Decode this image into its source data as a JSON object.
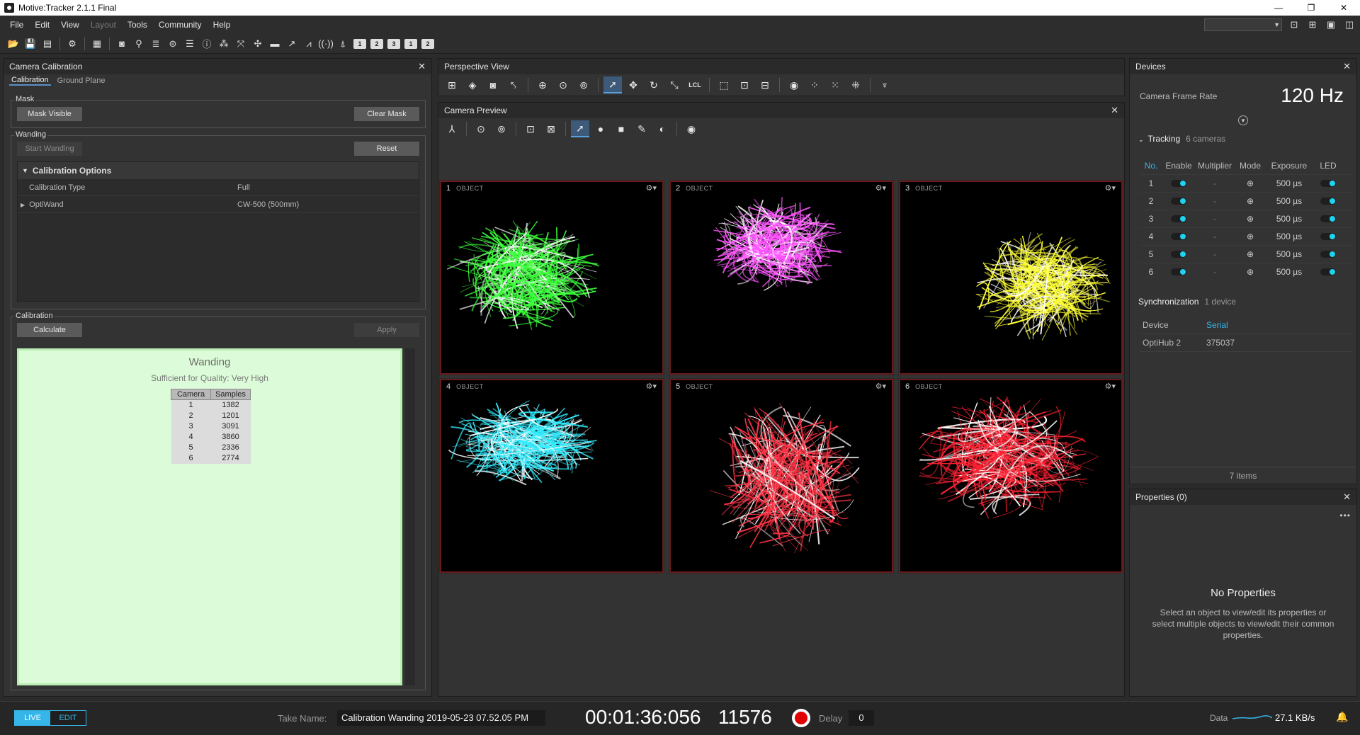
{
  "window": {
    "title": "Motive:Tracker 2.1.1 Final",
    "controls": [
      "—",
      "❐",
      "✕"
    ]
  },
  "menu": [
    "File",
    "Edit",
    "View",
    "Layout",
    "Tools",
    "Community",
    "Help"
  ],
  "toolbar_numbers": [
    "1",
    "2",
    "3",
    "1",
    "2"
  ],
  "calibration_panel": {
    "title": "Camera Calibration",
    "tabs": [
      "Calibration",
      "Ground Plane"
    ],
    "mask": {
      "title": "Mask",
      "mask_visible": "Mask Visible",
      "clear_mask": "Clear Mask"
    },
    "wanding": {
      "title": "Wanding",
      "start": "Start Wanding",
      "reset": "Reset",
      "options_title": "Calibration Options",
      "rows": [
        {
          "key": "Calibration Type",
          "value": "Full"
        },
        {
          "key": "OptiWand",
          "value": "CW-500 (500mm)"
        }
      ]
    },
    "calibration": {
      "title": "Calibration",
      "calculate": "Calculate",
      "apply": "Apply",
      "result_title": "Wanding",
      "result_sub": "Sufficient for Quality: Very High",
      "table_headers": [
        "Camera",
        "Samples"
      ],
      "table_rows": [
        [
          "1",
          "1382"
        ],
        [
          "2",
          "1201"
        ],
        [
          "3",
          "3091"
        ],
        [
          "4",
          "3860"
        ],
        [
          "5",
          "2336"
        ],
        [
          "6",
          "2774"
        ]
      ]
    }
  },
  "perspective": {
    "title": "Perspective View",
    "lcl_label": "LCL"
  },
  "camera_preview": {
    "title": "Camera Preview",
    "object_label": "OBJECT",
    "cameras": [
      {
        "num": "1",
        "color": "#3cff3c"
      },
      {
        "num": "2",
        "color": "#ff55ff"
      },
      {
        "num": "3",
        "color": "#ffff33"
      },
      {
        "num": "4",
        "color": "#33eeff"
      },
      {
        "num": "5",
        "color": "#ff3344"
      },
      {
        "num": "6",
        "color": "#ff2233"
      }
    ]
  },
  "devices": {
    "title": "Devices",
    "frame_rate_label": "Camera Frame Rate",
    "frame_rate_value": "120 Hz",
    "tracking_label": "Tracking",
    "tracking_sub": "6 cameras",
    "headers": [
      "No.",
      "Enable",
      "Multiplier",
      "Mode",
      "Exposure",
      "LED"
    ],
    "rows": [
      {
        "no": "1",
        "multiplier": "-",
        "exposure": "500 µs"
      },
      {
        "no": "2",
        "multiplier": "-",
        "exposure": "500 µs"
      },
      {
        "no": "3",
        "multiplier": "-",
        "exposure": "500 µs"
      },
      {
        "no": "4",
        "multiplier": "-",
        "exposure": "500 µs"
      },
      {
        "no": "5",
        "multiplier": "-",
        "exposure": "500 µs"
      },
      {
        "no": "6",
        "multiplier": "-",
        "exposure": "500 µs"
      }
    ],
    "sync_label": "Synchronization",
    "sync_sub": "1 device",
    "sync_headers": [
      "Device",
      "Serial"
    ],
    "sync_row": [
      "OptiHub 2",
      "375037"
    ],
    "items_count": "7 items"
  },
  "properties": {
    "title": "Properties (0)",
    "empty_title": "No Properties",
    "empty_text": "Select an object to view/edit its properties or select multiple objects to view/edit their common properties."
  },
  "status": {
    "live": "LIVE",
    "edit": "EDIT",
    "take_label": "Take Name:",
    "take_name": "Calibration Wanding 2019-05-23 07.52.05 PM",
    "timecode": "00:01:36:056",
    "frame": "11576",
    "delay_label": "Delay",
    "delay_value": "0",
    "data_label": "Data",
    "data_rate": "27.1 KB/s"
  }
}
